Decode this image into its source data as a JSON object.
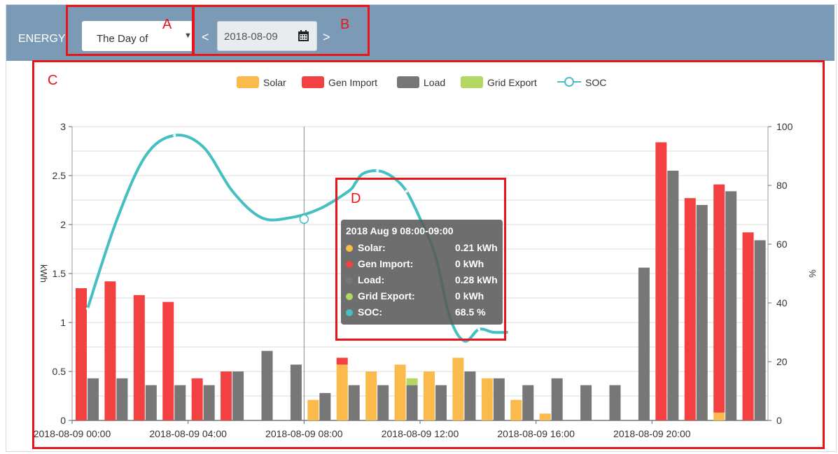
{
  "header": {
    "title": "ENERGY",
    "period_select": {
      "value": "The Day of"
    },
    "prev_label": "<",
    "next_label": ">",
    "date": "2018-08-09"
  },
  "annotations": {
    "A": "A",
    "B": "B",
    "C": "C",
    "D": "D",
    "color": "#e8151b"
  },
  "tooltip": {
    "title": "2018 Aug 9 08:00-09:00",
    "rows": [
      {
        "label": "Solar:",
        "value": "0.21 kWh",
        "color": "#fbbb4c"
      },
      {
        "label": "Gen Import:",
        "value": "0 kWh",
        "color": "#f34040"
      },
      {
        "label": "Load:",
        "value": "0.28 kWh",
        "color": "#777777"
      },
      {
        "label": "Grid Export:",
        "value": "0 kWh",
        "color": "#b4d764"
      },
      {
        "label": "SOC:",
        "value": "68.5 %",
        "color": "#45bfc1"
      }
    ]
  },
  "chart_data": {
    "type": "bar",
    "ylabel": "kWh",
    "y2label": "%",
    "ylim": [
      0,
      3
    ],
    "y2lim": [
      0,
      100
    ],
    "yticks": [
      "0",
      "0.5",
      "1",
      "1.5",
      "2",
      "2.5",
      "3"
    ],
    "y2ticks": [
      "0",
      "20",
      "40",
      "60",
      "80",
      "100"
    ],
    "xtick_labels": [
      "2018-08-09 00:00",
      "2018-08-09 04:00",
      "2018-08-09 08:00",
      "2018-08-09 12:00",
      "2018-08-09 16:00",
      "2018-08-09 20:00"
    ],
    "legend": [
      "Solar",
      "Gen Import",
      "Load",
      "Grid Export",
      "SOC"
    ],
    "legend_position": "top-center",
    "grid": true,
    "colors": {
      "solar": "#fbbb4c",
      "gen": "#f34040",
      "load": "#777777",
      "export": "#b4d764",
      "soc": "#45bfc1"
    },
    "x": [
      "00:00",
      "01:00",
      "02:00",
      "03:00",
      "04:00",
      "05:00",
      "06:00",
      "07:00",
      "08:00",
      "09:00",
      "10:00",
      "11:00",
      "12:00",
      "13:00",
      "14:00",
      "15:00",
      "16:00",
      "17:00",
      "18:00",
      "19:00",
      "20:00",
      "21:00",
      "22:00",
      "23:00"
    ],
    "series": [
      {
        "name": "Solar",
        "values": [
          0,
          0,
          0,
          0,
          0,
          0,
          0,
          0,
          0.21,
          0.57,
          0.5,
          0.57,
          0.5,
          0.64,
          0.43,
          0.21,
          0.07,
          0,
          0,
          0,
          0,
          0,
          0.08,
          0
        ]
      },
      {
        "name": "Gen Import",
        "values": [
          1.35,
          1.42,
          1.28,
          1.21,
          0.43,
          0.5,
          0,
          0,
          0,
          0.07,
          0,
          0,
          0,
          0,
          0,
          0,
          0,
          0,
          0,
          0,
          2.84,
          2.27,
          2.33,
          1.92
        ]
      },
      {
        "name": "Load",
        "values": [
          0.43,
          0.43,
          0.36,
          0.36,
          0.36,
          0.5,
          0.71,
          0.57,
          0.28,
          0.36,
          0.36,
          0.36,
          0.36,
          0.5,
          0.43,
          0.36,
          0.43,
          0.36,
          0.36,
          1.56,
          2.55,
          2.2,
          2.34,
          1.84
        ]
      },
      {
        "name": "Grid Export",
        "values": [
          0,
          0,
          0,
          0,
          0,
          0,
          0,
          0,
          0,
          0,
          0,
          0.07,
          0,
          0,
          0,
          0,
          0,
          0,
          0,
          0,
          0,
          0,
          0,
          0
        ]
      },
      {
        "name": "SOC",
        "values": [
          38,
          68,
          90,
          97,
          93,
          78,
          69,
          69,
          72,
          78,
          81,
          84,
          85,
          83,
          78,
          68,
          56,
          35,
          27,
          31,
          30,
          30
        ]
      }
    ],
    "soc_x": [
      0,
      2,
      4,
      6,
      8,
      10,
      12,
      14,
      16,
      18,
      18.5,
      19,
      20,
      21,
      22,
      23,
      24,
      25,
      26,
      27,
      28,
      29
    ],
    "highlight_index": 8
  }
}
